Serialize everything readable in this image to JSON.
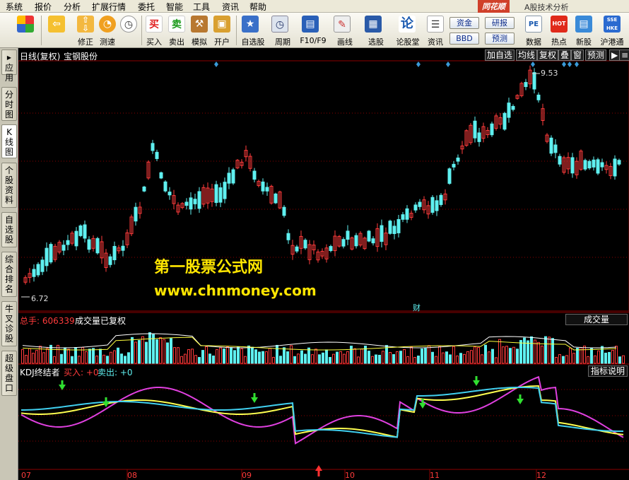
{
  "menu": [
    "系统",
    "报价",
    "分析",
    "扩展行情",
    "委托",
    "智能",
    "工具",
    "资讯",
    "帮助"
  ],
  "brand": "同花顺",
  "window_title": "A股技术分析",
  "toolbar": {
    "buttons": [
      {
        "label": "",
        "icon": "grid-icon"
      },
      {
        "label": "",
        "icon": "back-arrow-icon"
      },
      {
        "label": "修正",
        "icon": "updown-arrows-icon"
      },
      {
        "label": "测速",
        "icon": "clock-icon"
      },
      {
        "label": "买入",
        "glyph": "买",
        "icon": "buy-icon"
      },
      {
        "label": "卖出",
        "glyph": "卖",
        "icon": "sell-icon"
      },
      {
        "label": "模拟",
        "icon": "hammer-icon"
      },
      {
        "label": "开户",
        "icon": "lock-icon"
      },
      {
        "label": "自选股",
        "icon": "star-window-icon"
      },
      {
        "label": "周期",
        "icon": "clock-period-icon"
      },
      {
        "label": "F10/F9",
        "icon": "f10-icon"
      },
      {
        "label": "画线",
        "icon": "pencil-icon"
      },
      {
        "label": "选股",
        "icon": "select-stock-icon"
      },
      {
        "label": "论股堂",
        "glyph": "论",
        "icon": "forum-icon"
      },
      {
        "label": "资讯",
        "icon": "news-icon"
      },
      {
        "label": "数据",
        "glyph": "PE",
        "icon": "data-icon"
      },
      {
        "label": "热点",
        "glyph": "HOT",
        "icon": "hot-icon"
      },
      {
        "label": "新股",
        "icon": "new-stock-icon"
      },
      {
        "label": "沪港通",
        "glyph": "SSE HKE",
        "icon": "hk-connect-icon"
      }
    ],
    "mini": {
      "fund": "资金",
      "bbd": "BBD",
      "research": "研报",
      "forecast": "预测"
    }
  },
  "left_tabs": [
    {
      "label": "应用"
    },
    {
      "label": "分时图"
    },
    {
      "label": "K线图",
      "active": true
    },
    {
      "label": "个股资料"
    },
    {
      "label": "自选股"
    },
    {
      "label": "综合排名"
    },
    {
      "label": "牛叉诊股"
    },
    {
      "label": "超级盘口"
    }
  ],
  "main_panel": {
    "period": "日线(复权)",
    "stock_name": "宝钢股份",
    "buttons": [
      "加自选",
      "均线",
      "复权",
      "叠",
      "窗",
      "预测"
    ],
    "high_label": "9.53",
    "low_label": "6.72",
    "cai_label": "财",
    "watermark_line1": "第一股票公式网",
    "watermark_line2": "www.chnmoney.com"
  },
  "volume_panel": {
    "total_label": "总手: 606339",
    "title": "成交量已复权",
    "selector": "成交量"
  },
  "kdj_panel": {
    "name": "KDJ终结者",
    "buy_label": "买入: +0",
    "sell_label": "卖出: +0",
    "help_button": "指标说明"
  },
  "x_axis_months": [
    "07",
    "08",
    "09",
    "10",
    "11",
    "12"
  ],
  "colors": {
    "up": "#ff3b3b",
    "down": "#5ff0f0",
    "ma_white": "#ffffff",
    "ma_yellow": "#ffff3c",
    "kdj_magenta": "#e040e0",
    "kdj_yellow": "#ffff50",
    "kdj_cyan": "#40d0f0",
    "grid": "#8b0000",
    "buy_arrow": "#30e030",
    "sell_arrow": "#ff3030"
  }
}
